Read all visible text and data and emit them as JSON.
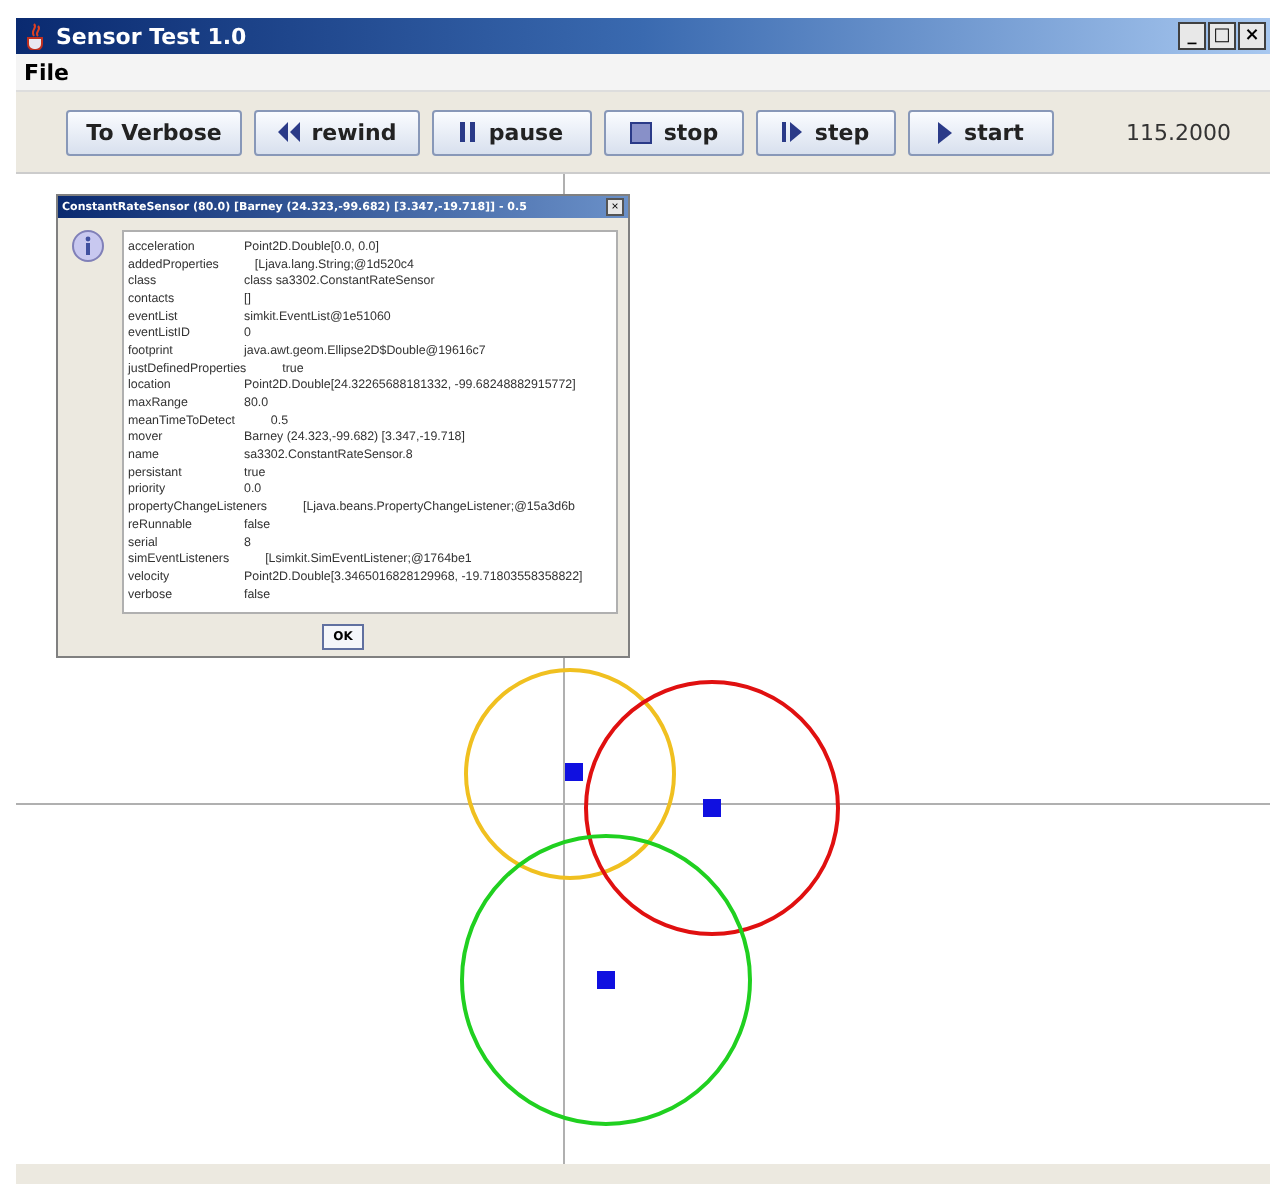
{
  "window": {
    "title": "Sensor Test 1.0",
    "controls": [
      "_",
      "□",
      "×"
    ]
  },
  "menu": [
    "File"
  ],
  "toolbar": {
    "buttons": [
      {
        "kind": "text",
        "label": "To Verbose"
      },
      {
        "kind": "rewind",
        "label": "rewind"
      },
      {
        "kind": "pause",
        "label": "pause"
      },
      {
        "kind": "stop",
        "label": "stop"
      },
      {
        "kind": "step",
        "label": "step"
      },
      {
        "kind": "start",
        "label": "start"
      }
    ],
    "time": "115.2000"
  },
  "dialog": {
    "title": "ConstantRateSensor (80.0) [Barney (24.323,-99.682) [3.347,-19.718]] - 0.5",
    "close": "×",
    "properties": [
      {
        "name": "acceleration",
        "value": "Point2D.Double[0.0, 0.0]"
      },
      {
        "name": "addedProperties",
        "value": "[Ljava.lang.String;@1d520c4"
      },
      {
        "name": "class",
        "value": "class sa3302.ConstantRateSensor"
      },
      {
        "name": "contacts",
        "value": "[]"
      },
      {
        "name": "eventList",
        "value": "simkit.EventList@1e51060"
      },
      {
        "name": "eventListID",
        "value": "0"
      },
      {
        "name": "footprint",
        "value": "java.awt.geom.Ellipse2D$Double@19616c7"
      },
      {
        "name": "justDefinedProperties",
        "value": "true"
      },
      {
        "name": "location",
        "value": "Point2D.Double[24.32265688181332, -99.68248882915772]"
      },
      {
        "name": "maxRange",
        "value": "80.0"
      },
      {
        "name": "meanTimeToDetect",
        "value": "0.5"
      },
      {
        "name": "mover",
        "value": "Barney (24.323,-99.682) [3.347,-19.718]"
      },
      {
        "name": "name",
        "value": "sa3302.ConstantRateSensor.8"
      },
      {
        "name": "persistant",
        "value": "true"
      },
      {
        "name": "priority",
        "value": "0.0"
      },
      {
        "name": "propertyChangeListeners",
        "value": "[Ljava.beans.PropertyChangeListener;@15a3d6b"
      },
      {
        "name": "reRunnable",
        "value": "false"
      },
      {
        "name": "serial",
        "value": "8"
      },
      {
        "name": "simEventListeners",
        "value": "[Lsimkit.SimEventListener;@1764be1"
      },
      {
        "name": "velocity",
        "value": "Point2D.Double[3.3465016828129968, -19.71803558358822]"
      },
      {
        "name": "verbose",
        "value": "false"
      }
    ],
    "ok": "OK"
  },
  "sensors": [
    {
      "color": "#f0c020"
    },
    {
      "color": "#e01010"
    },
    {
      "color": "#20d020"
    }
  ]
}
